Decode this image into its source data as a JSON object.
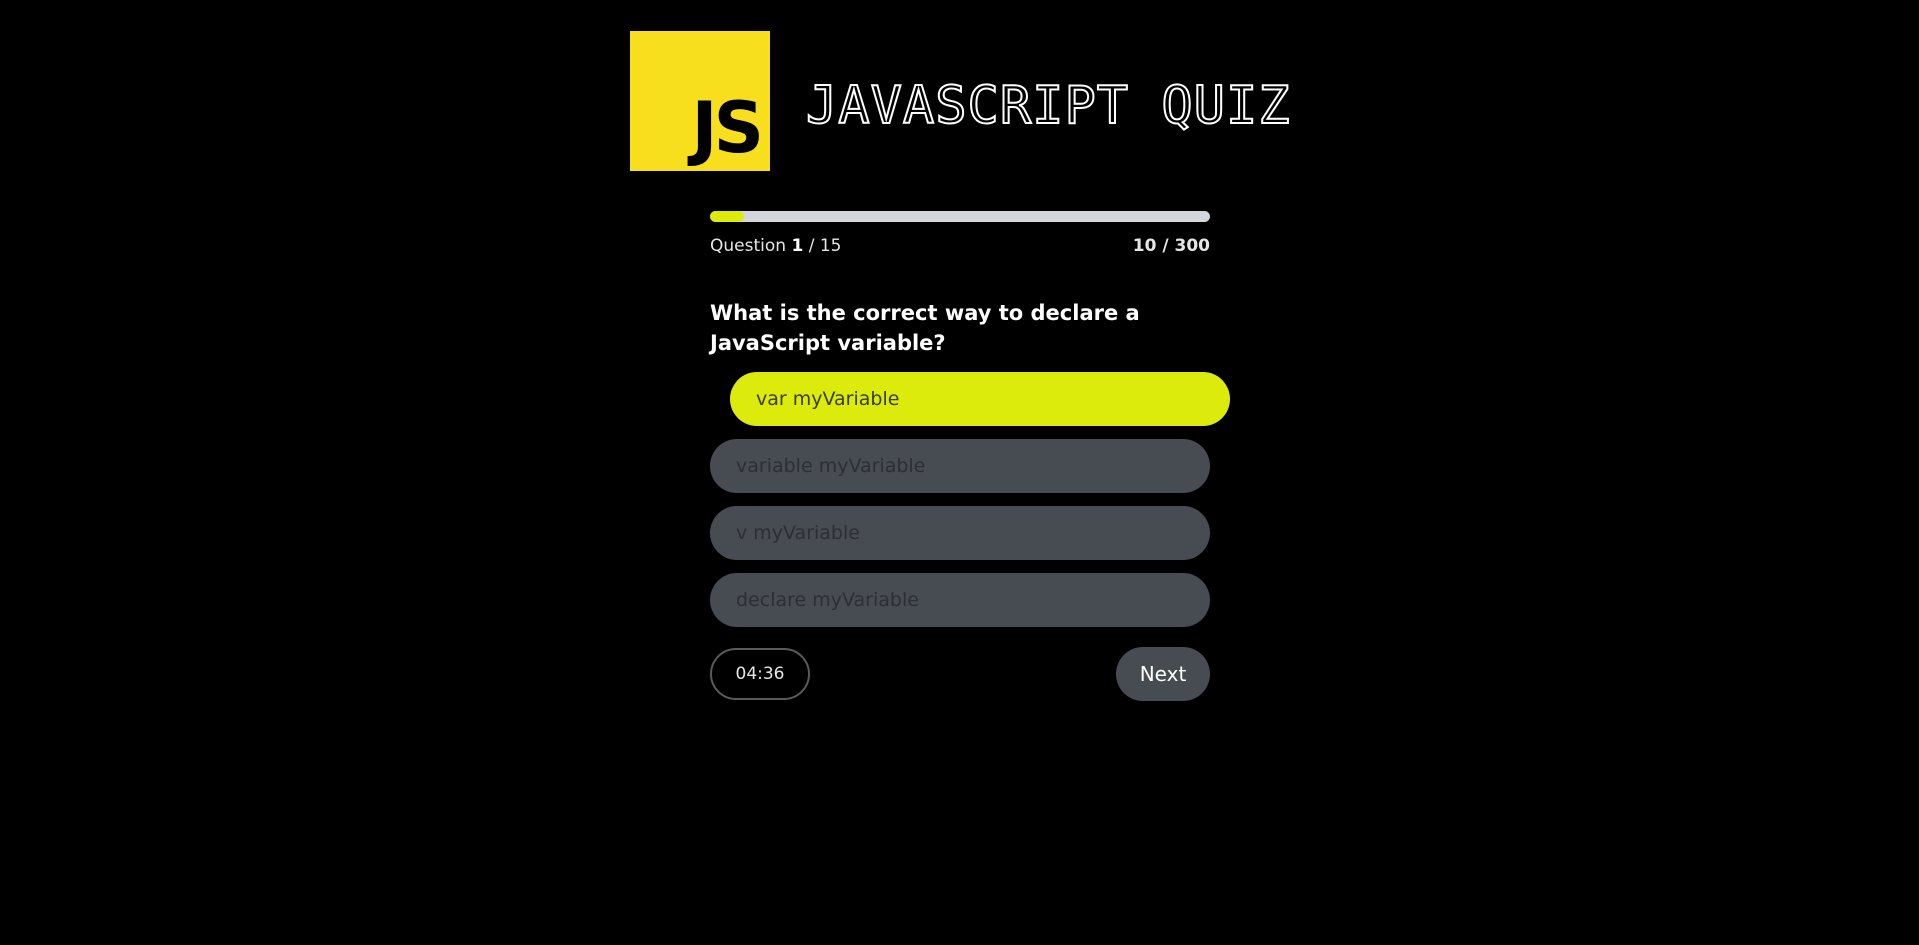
{
  "header": {
    "logo_text": "JS",
    "title": "JAVASCRIPT QUIZ"
  },
  "progress": {
    "label": "Question",
    "current": "1",
    "separator": "/ 15",
    "fraction": 0.067,
    "score": "10 / 300"
  },
  "question": {
    "text": "What is the correct way to declare a JavaScript variable?"
  },
  "options": [
    {
      "label": "var myVariable",
      "selected": true
    },
    {
      "label": "variable myVariable",
      "selected": false
    },
    {
      "label": "v myVariable",
      "selected": false
    },
    {
      "label": "declare myVariable",
      "selected": false
    }
  ],
  "footer": {
    "timer": "04:36",
    "next_label": "Next"
  },
  "colors": {
    "background": "#000000",
    "logo_yellow": "#f7df1e",
    "accent": "#dceb0c",
    "option_bg": "#474b52",
    "track": "#d3d6dc"
  }
}
